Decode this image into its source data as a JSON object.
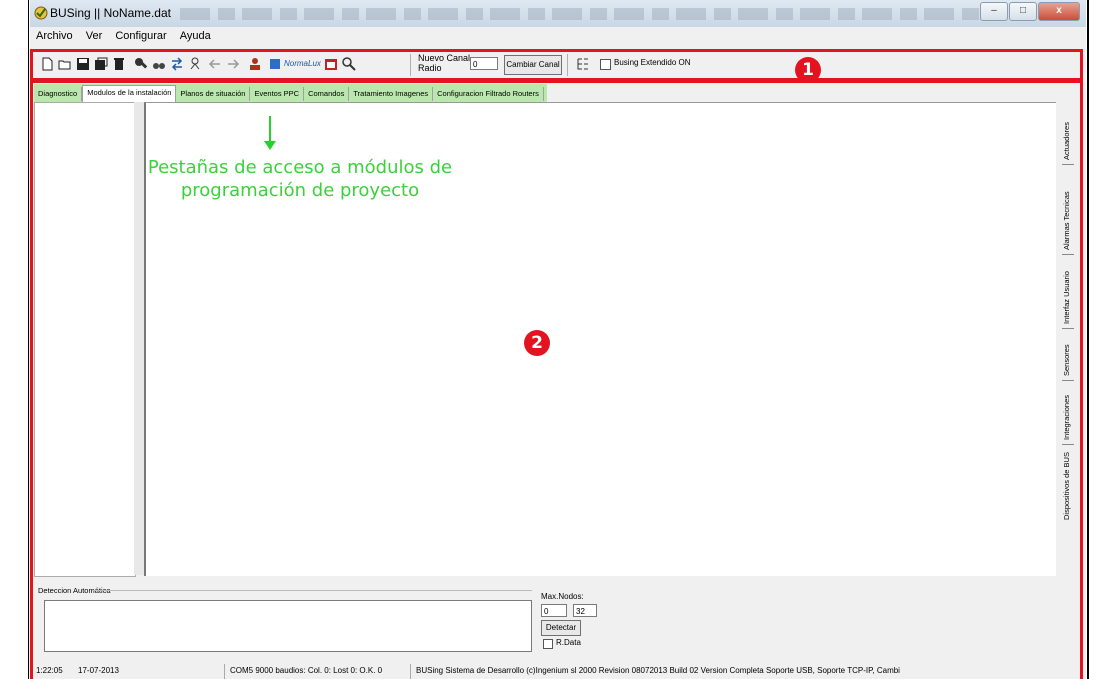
{
  "window": {
    "title": "BUSing || NoName.dat",
    "buttons": {
      "minimize": "–",
      "maximize": "□",
      "close": "x"
    }
  },
  "menu": [
    "Archivo",
    "Ver",
    "Configurar",
    "Ayuda"
  ],
  "toolbar": {
    "icons": [
      "new-file-icon",
      "open-folder-icon",
      "save-icon",
      "save-as-icon",
      "delete-icon",
      "tool-icon",
      "binoculars-icon",
      "transfer-icon",
      "network-icon",
      "back-arrow-icon",
      "forward-arrow-icon",
      "user-icon",
      "normalux-icon",
      "calendar-icon",
      "zoom-icon"
    ],
    "normalux_label": "NormaLux",
    "nuevo_canal_label": "Nuevo Canal\nRadio",
    "nuevo_canal_value": "0",
    "cambiar_canal_label": "Cambiar Canal",
    "busing_extendido_label": "Busing Extendido ON",
    "busing_extendido_checked": false
  },
  "badges": {
    "one": "1",
    "two": "2"
  },
  "tabs": [
    {
      "label": "Diagnostico",
      "active": false
    },
    {
      "label": "Modulos de la instalación",
      "active": true
    },
    {
      "label": "Planos de situación",
      "active": false
    },
    {
      "label": "Eventos PPC",
      "active": false
    },
    {
      "label": "Comandos",
      "active": false
    },
    {
      "label": "Tratamiento Imagenes",
      "active": false
    },
    {
      "label": "Configuracion Filtrado Routers",
      "active": false
    }
  ],
  "annotation": "Pestañas de acceso a módulos de programación de proyecto",
  "side_tabs": [
    "Actuadores",
    "Alarmas Tecnicas",
    "Interfaz Usuario",
    "Sensores",
    "Integraciones",
    "Dispositivos de BUS"
  ],
  "deteccion": {
    "label": "Deteccion Automática",
    "max_nodos_label": "Max.Nodos:",
    "max_nodos_from": "0",
    "max_nodos_to": "32",
    "detectar_label": "Detectar",
    "rdata_label": "R.Data",
    "rdata_checked": false
  },
  "status": {
    "time": "1:22:05",
    "date": "17-07-2013",
    "com": "COM5 9000 baudios: Col. 0: Lost 0: O.K. 0",
    "info": "BUSing Sistema de Desarrollo (c)Ingenium sl 2000 Revision 08072013 Build 02 Version Completa Soporte USB, Soporte TCP-IP, Cambi"
  },
  "colors": {
    "highlight_red": "#e3141f",
    "annotation_green": "#3bd13b",
    "tab_highlight": "#78dc5a"
  }
}
